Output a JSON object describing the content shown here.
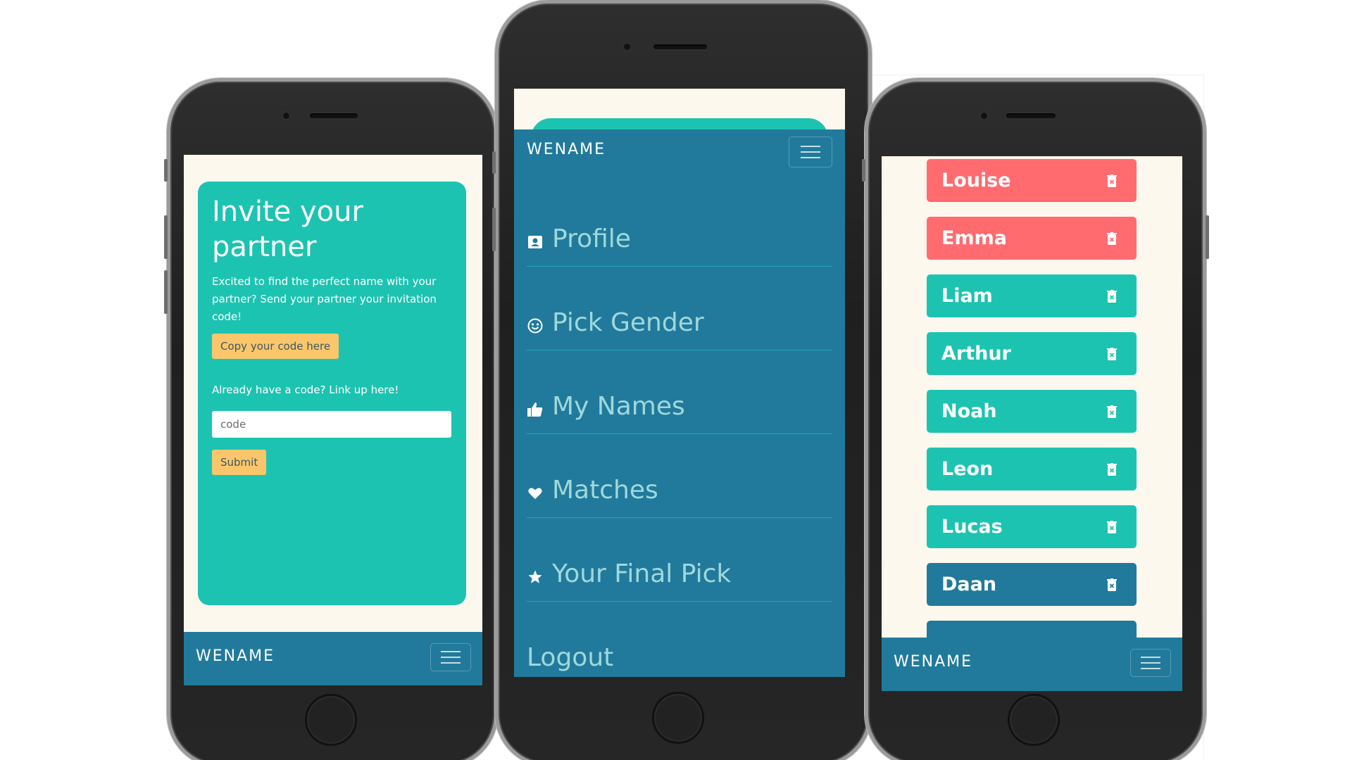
{
  "brand": "WENAME",
  "colors": {
    "navbar": "#217a9b",
    "teal": "#1dc3b1",
    "coral": "#ff6b6f",
    "dark_blue": "#217a9b",
    "yellow": "#fbc66b",
    "cream": "#fdf8ee",
    "menu_text": "#9fd8dc"
  },
  "invite": {
    "title": "Invite your partner",
    "text": "Excited to find the perfect name with your partner? Send your partner your invitation code!",
    "copy_button": "Copy your code here",
    "already_text": "Already have a code? Link up here!",
    "code_placeholder": "code",
    "code_value": "",
    "submit_button": "Submit"
  },
  "menu": {
    "items": [
      {
        "label": "Profile",
        "icon": "profile-card-icon"
      },
      {
        "label": "Pick Gender",
        "icon": "smiley-icon"
      },
      {
        "label": "My Names",
        "icon": "thumbs-up-icon"
      },
      {
        "label": "Matches",
        "icon": "heart-icon"
      },
      {
        "label": "Your Final Pick",
        "icon": "star-icon"
      },
      {
        "label": "Logout",
        "icon": ""
      }
    ]
  },
  "names": {
    "items": [
      {
        "name": "Louise",
        "color": "#ff6b6f"
      },
      {
        "name": "Emma",
        "color": "#ff6b6f"
      },
      {
        "name": "Liam",
        "color": "#1dc3b1"
      },
      {
        "name": "Arthur",
        "color": "#1dc3b1"
      },
      {
        "name": "Noah",
        "color": "#1dc3b1"
      },
      {
        "name": "Leon",
        "color": "#1dc3b1"
      },
      {
        "name": "Lucas",
        "color": "#1dc3b1"
      },
      {
        "name": "Daan",
        "color": "#217a9b"
      },
      {
        "name": "",
        "color": "#217a9b"
      }
    ],
    "item_icon": "trash-icon"
  }
}
